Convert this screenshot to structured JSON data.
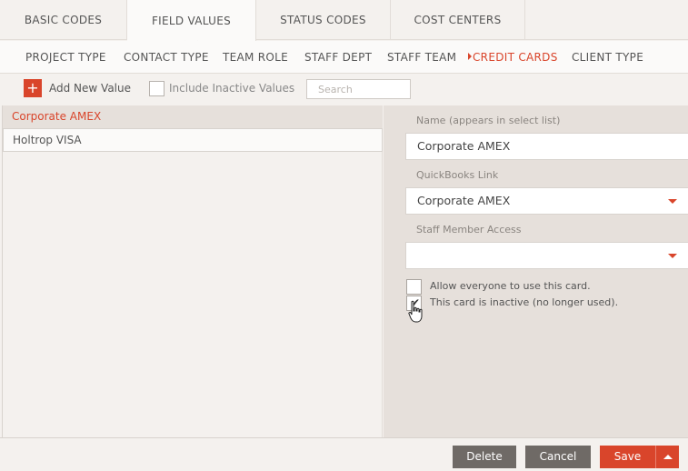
{
  "top_tabs": [
    {
      "label": "BASIC CODES"
    },
    {
      "label": "FIELD VALUES"
    },
    {
      "label": "STATUS CODES"
    },
    {
      "label": "COST CENTERS"
    }
  ],
  "sub_tabs": [
    {
      "label": "PROJECT TYPE"
    },
    {
      "label": "CONTACT TYPE"
    },
    {
      "label": "TEAM ROLE"
    },
    {
      "label": "STAFF DEPT"
    },
    {
      "label": "STAFF TEAM"
    },
    {
      "label": "CREDIT CARDS"
    },
    {
      "label": "CLIENT TYPE"
    }
  ],
  "toolbar": {
    "add_icon": "+",
    "add_label": "Add New Value",
    "include_inactive_label": "Include Inactive Values",
    "search_placeholder": "Search"
  },
  "list": {
    "items": [
      {
        "label": "Corporate AMEX"
      },
      {
        "label": "Holtrop VISA"
      }
    ]
  },
  "form": {
    "name_label": "Name (appears in select list)",
    "name_value": "Corporate AMEX",
    "quickbooks_label": "QuickBooks Link",
    "quickbooks_value": "Corporate AMEX",
    "staff_access_label": "Staff Member Access",
    "staff_access_value": "",
    "allow_everyone_label": "Allow everyone to use this card.",
    "allow_everyone_checked": false,
    "inactive_label": "This card is inactive (no longer used).",
    "inactive_checked": true
  },
  "buttons": {
    "delete": "Delete",
    "cancel": "Cancel",
    "save": "Save"
  },
  "colors": {
    "accent": "#d9452b",
    "button_gray": "#6f6a66"
  }
}
